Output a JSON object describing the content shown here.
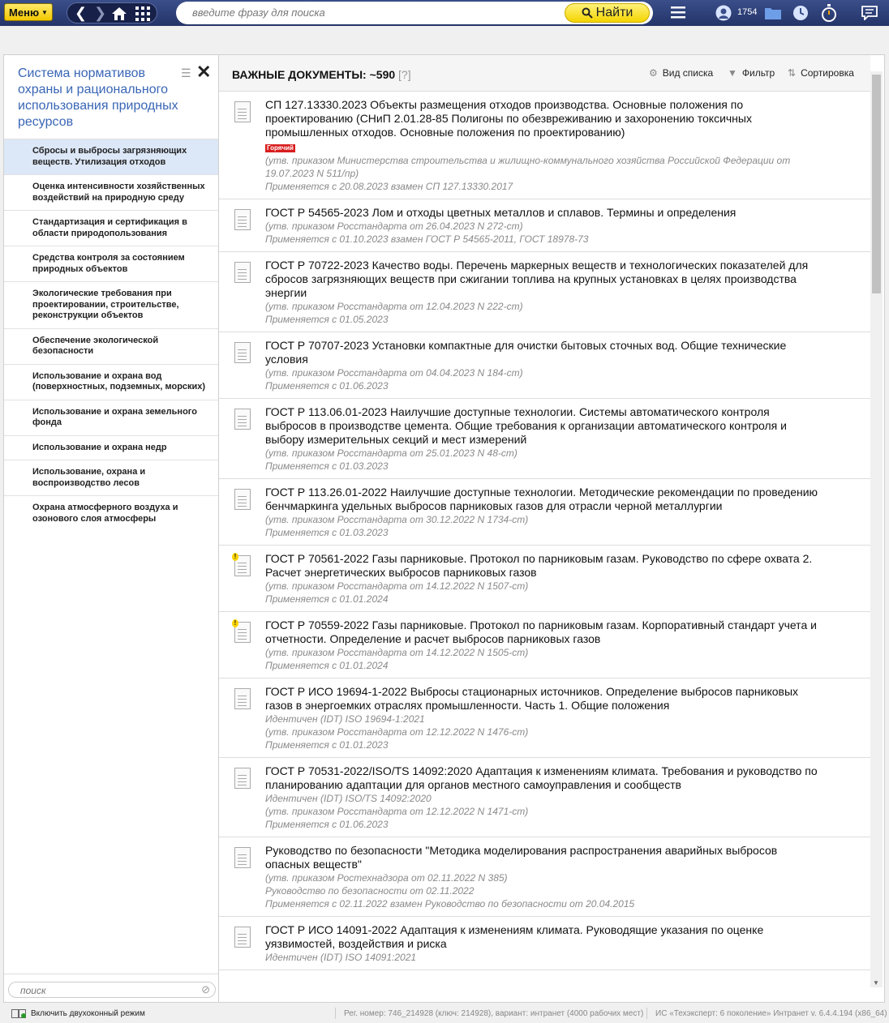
{
  "topbar": {
    "menu_label": "Меню",
    "search_placeholder": "введите фразу для поиска",
    "find_label": "Найти",
    "user_count": "1754"
  },
  "sidebar": {
    "title": "Система нормативов охраны и рационального использования природных ресурсов",
    "items": [
      {
        "label": "Сбросы и выбросы загрязняющих веществ. Утилизация отходов",
        "active": true
      },
      {
        "label": "Оценка интенсивности хозяйственных воздействий на природную среду"
      },
      {
        "label": "Стандартизация и сертификация в области природопользования"
      },
      {
        "label": "Средства контроля за состоянием природных объектов"
      },
      {
        "label": "Экологические требования при проектировании, строительстве, реконструкции объектов"
      },
      {
        "label": "Обеспечение экологической безопасности"
      },
      {
        "label": "Использование и охрана вод (поверхностных, подземных, морских)"
      },
      {
        "label": "Использование и охрана земельного фонда"
      },
      {
        "label": "Использование и охрана недр"
      },
      {
        "label": "Использование, охрана и воспроизводство лесов"
      },
      {
        "label": "Охрана атмосферного воздуха и озонового слоя атмосферы"
      }
    ],
    "search_placeholder": "поиск"
  },
  "main": {
    "title": "ВАЖНЫЕ ДОКУМЕНТЫ: ~590",
    "help": "[?]",
    "view_label": "Вид списка",
    "filter_label": "Фильтр",
    "sort_label": "Сортировка",
    "docs": [
      {
        "title": "СП 127.13330.2023 Объекты размещения отходов производства. Основные положения по проектированию (СНиП 2.01.28-85 Полигоны по обезвреживанию и захоронению токсичных промышленных отходов. Основные положения по проектированию)",
        "hot": "Горячий",
        "meta": [
          "(утв. приказом Министерства строительства и жилищно-коммунального хозяйства Российской Федерации от 19.07.2023 N 511/пр)",
          "Применяется с 20.08.2023 взамен СП 127.13330.2017"
        ]
      },
      {
        "title": "ГОСТ Р 54565-2023 Лом и отходы цветных металлов и сплавов. Термины и определения",
        "meta": [
          "(утв. приказом Росстандарта от 26.04.2023 N 272-ст)",
          "Применяется с 01.10.2023 взамен ГОСТ Р 54565-2011, ГОСТ 18978-73"
        ]
      },
      {
        "title": "ГОСТ Р 70722-2023 Качество воды. Перечень маркерных веществ и технологических показателей для сбросов загрязняющих веществ при сжигании топлива на крупных установках в целях производства энергии",
        "meta": [
          "(утв. приказом Росстандарта от 12.04.2023 N 222-ст)",
          "Применяется с 01.05.2023"
        ]
      },
      {
        "title": "ГОСТ Р 70707-2023 Установки компактные для очистки бытовых сточных вод. Общие технические условия",
        "meta": [
          "(утв. приказом Росстандарта от 04.04.2023 N 184-ст)",
          "Применяется с 01.06.2023"
        ]
      },
      {
        "title": "ГОСТ Р 113.06.01-2023 Наилучшие доступные технологии. Системы автоматического контроля выбросов в производстве цемента. Общие требования к организации автоматического контроля и выбору измерительных секций и мест измерений",
        "meta": [
          "(утв. приказом Росстандарта от 25.01.2023 N 48-ст)",
          "Применяется с 01.03.2023"
        ]
      },
      {
        "title": "ГОСТ Р 113.26.01-2022 Наилучшие доступные технологии. Методические рекомендации по проведению бенчмаркинга удельных выбросов парниковых газов для отрасли черной металлургии",
        "meta": [
          "(утв. приказом Росстандарта от 30.12.2022 N 1734-ст)",
          "Применяется с 01.03.2023"
        ]
      },
      {
        "title": "ГОСТ Р 70561-2022 Газы парниковые. Протокол по парниковым газам. Руководство по сфере охвата 2. Расчет энергетических выбросов парниковых газов",
        "warn": true,
        "meta": [
          "(утв. приказом Росстандарта от 14.12.2022 N 1507-ст)",
          "Применяется с 01.01.2024"
        ]
      },
      {
        "title": "ГОСТ Р 70559-2022 Газы парниковые. Протокол по парниковым газам. Корпоративный стандарт учета и отчетности. Определение и расчет выбросов парниковых газов",
        "warn": true,
        "meta": [
          "(утв. приказом Росстандарта от 14.12.2022 N 1505-ст)",
          "Применяется с 01.01.2024"
        ]
      },
      {
        "title": "ГОСТ Р ИСО 19694-1-2022 Выбросы стационарных источников. Определение выбросов парниковых газов в энергоемких отраслях промышленности. Часть 1. Общие положения",
        "meta": [
          "Идентичен (IDT) ISO 19694-1:2021",
          "(утв. приказом Росстандарта от 12.12.2022 N 1476-ст)",
          "Применяется с 01.01.2023"
        ]
      },
      {
        "title": "ГОСТ Р 70531-2022/ISO/TS 14092:2020 Адаптация к изменениям климата. Требования и руководство по планированию адаптации для органов местного самоуправления и сообществ",
        "meta": [
          "Идентичен (IDT) ISO/TS 14092:2020",
          "(утв. приказом Росстандарта от 12.12.2022 N 1471-ст)",
          "Применяется с 01.06.2023"
        ]
      },
      {
        "title": "Руководство по безопасности \"Методика моделирования распространения аварийных выбросов опасных веществ\"",
        "meta": [
          "(утв. приказом Ростехнадзора от 02.11.2022 N 385)",
          "Руководство по безопасности от 02.11.2022",
          "Применяется с 02.11.2022 взамен Руководство по безопасности от 20.04.2015"
        ]
      },
      {
        "title": "ГОСТ Р ИСО 14091-2022 Адаптация к изменениям климата. Руководящие указания по оценке уязвимостей, воздействия и риска",
        "meta": [
          "Идентичен (IDT) ISO 14091:2021"
        ]
      }
    ]
  },
  "footer": {
    "dual_window": "Включить двухоконный режим",
    "reg": "Рег. номер: 746_214928 (ключ: 214928), вариант: интранет (4000 рабочих мест)",
    "version": "ИС «Техэксперт: 6 поколение» Интранет v. 6.4.4.194 (x86_64)"
  }
}
